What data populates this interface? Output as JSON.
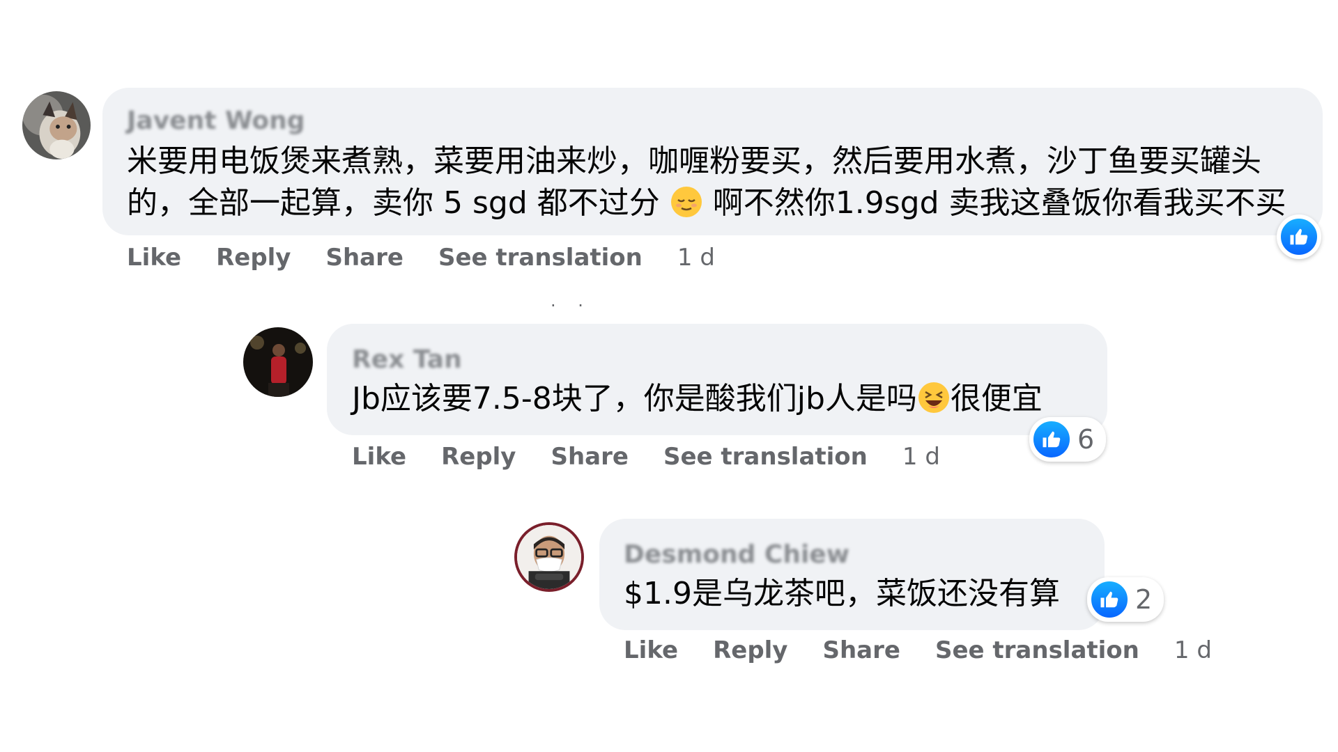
{
  "comments": [
    {
      "author": "Javent Wong",
      "text_line1": "米要用电饭煲来煮熟，菜要用油来炒，咖喱粉要买，然后要用水煮，沙丁鱼要买罐头",
      "text_line2_a": "的，全部一起算，卖你 5 sgd 都不过分",
      "emoji": "relieved-face",
      "text_line2_b": "啊不然你1.9sgd 卖我这叠饭你看我买不买",
      "actions": {
        "like": "Like",
        "reply": "Reply",
        "share": "Share",
        "translate": "See translation",
        "time": "1 d"
      },
      "reaction_count": ""
    },
    {
      "author": "Rex Tan",
      "text_a": "Jb应该要7.5-8块了，你是酸我们jb人是吗",
      "emoji": "laughing-face",
      "text_b": "很便宜",
      "actions": {
        "like": "Like",
        "reply": "Reply",
        "share": "Share",
        "translate": "See translation",
        "time": "1 d"
      },
      "reaction_count": "6"
    },
    {
      "author": "Desmond Chiew",
      "text": "$1.9是乌龙茶吧，菜饭还没有算",
      "actions": {
        "like": "Like",
        "reply": "Reply",
        "share": "Share",
        "translate": "See translation",
        "time": "1 d"
      },
      "reaction_count": "2"
    }
  ],
  "colors": {
    "bubble": "#f0f2f5",
    "like_blue": "#0866ff",
    "action_gray": "#65676b",
    "text": "#050505"
  }
}
